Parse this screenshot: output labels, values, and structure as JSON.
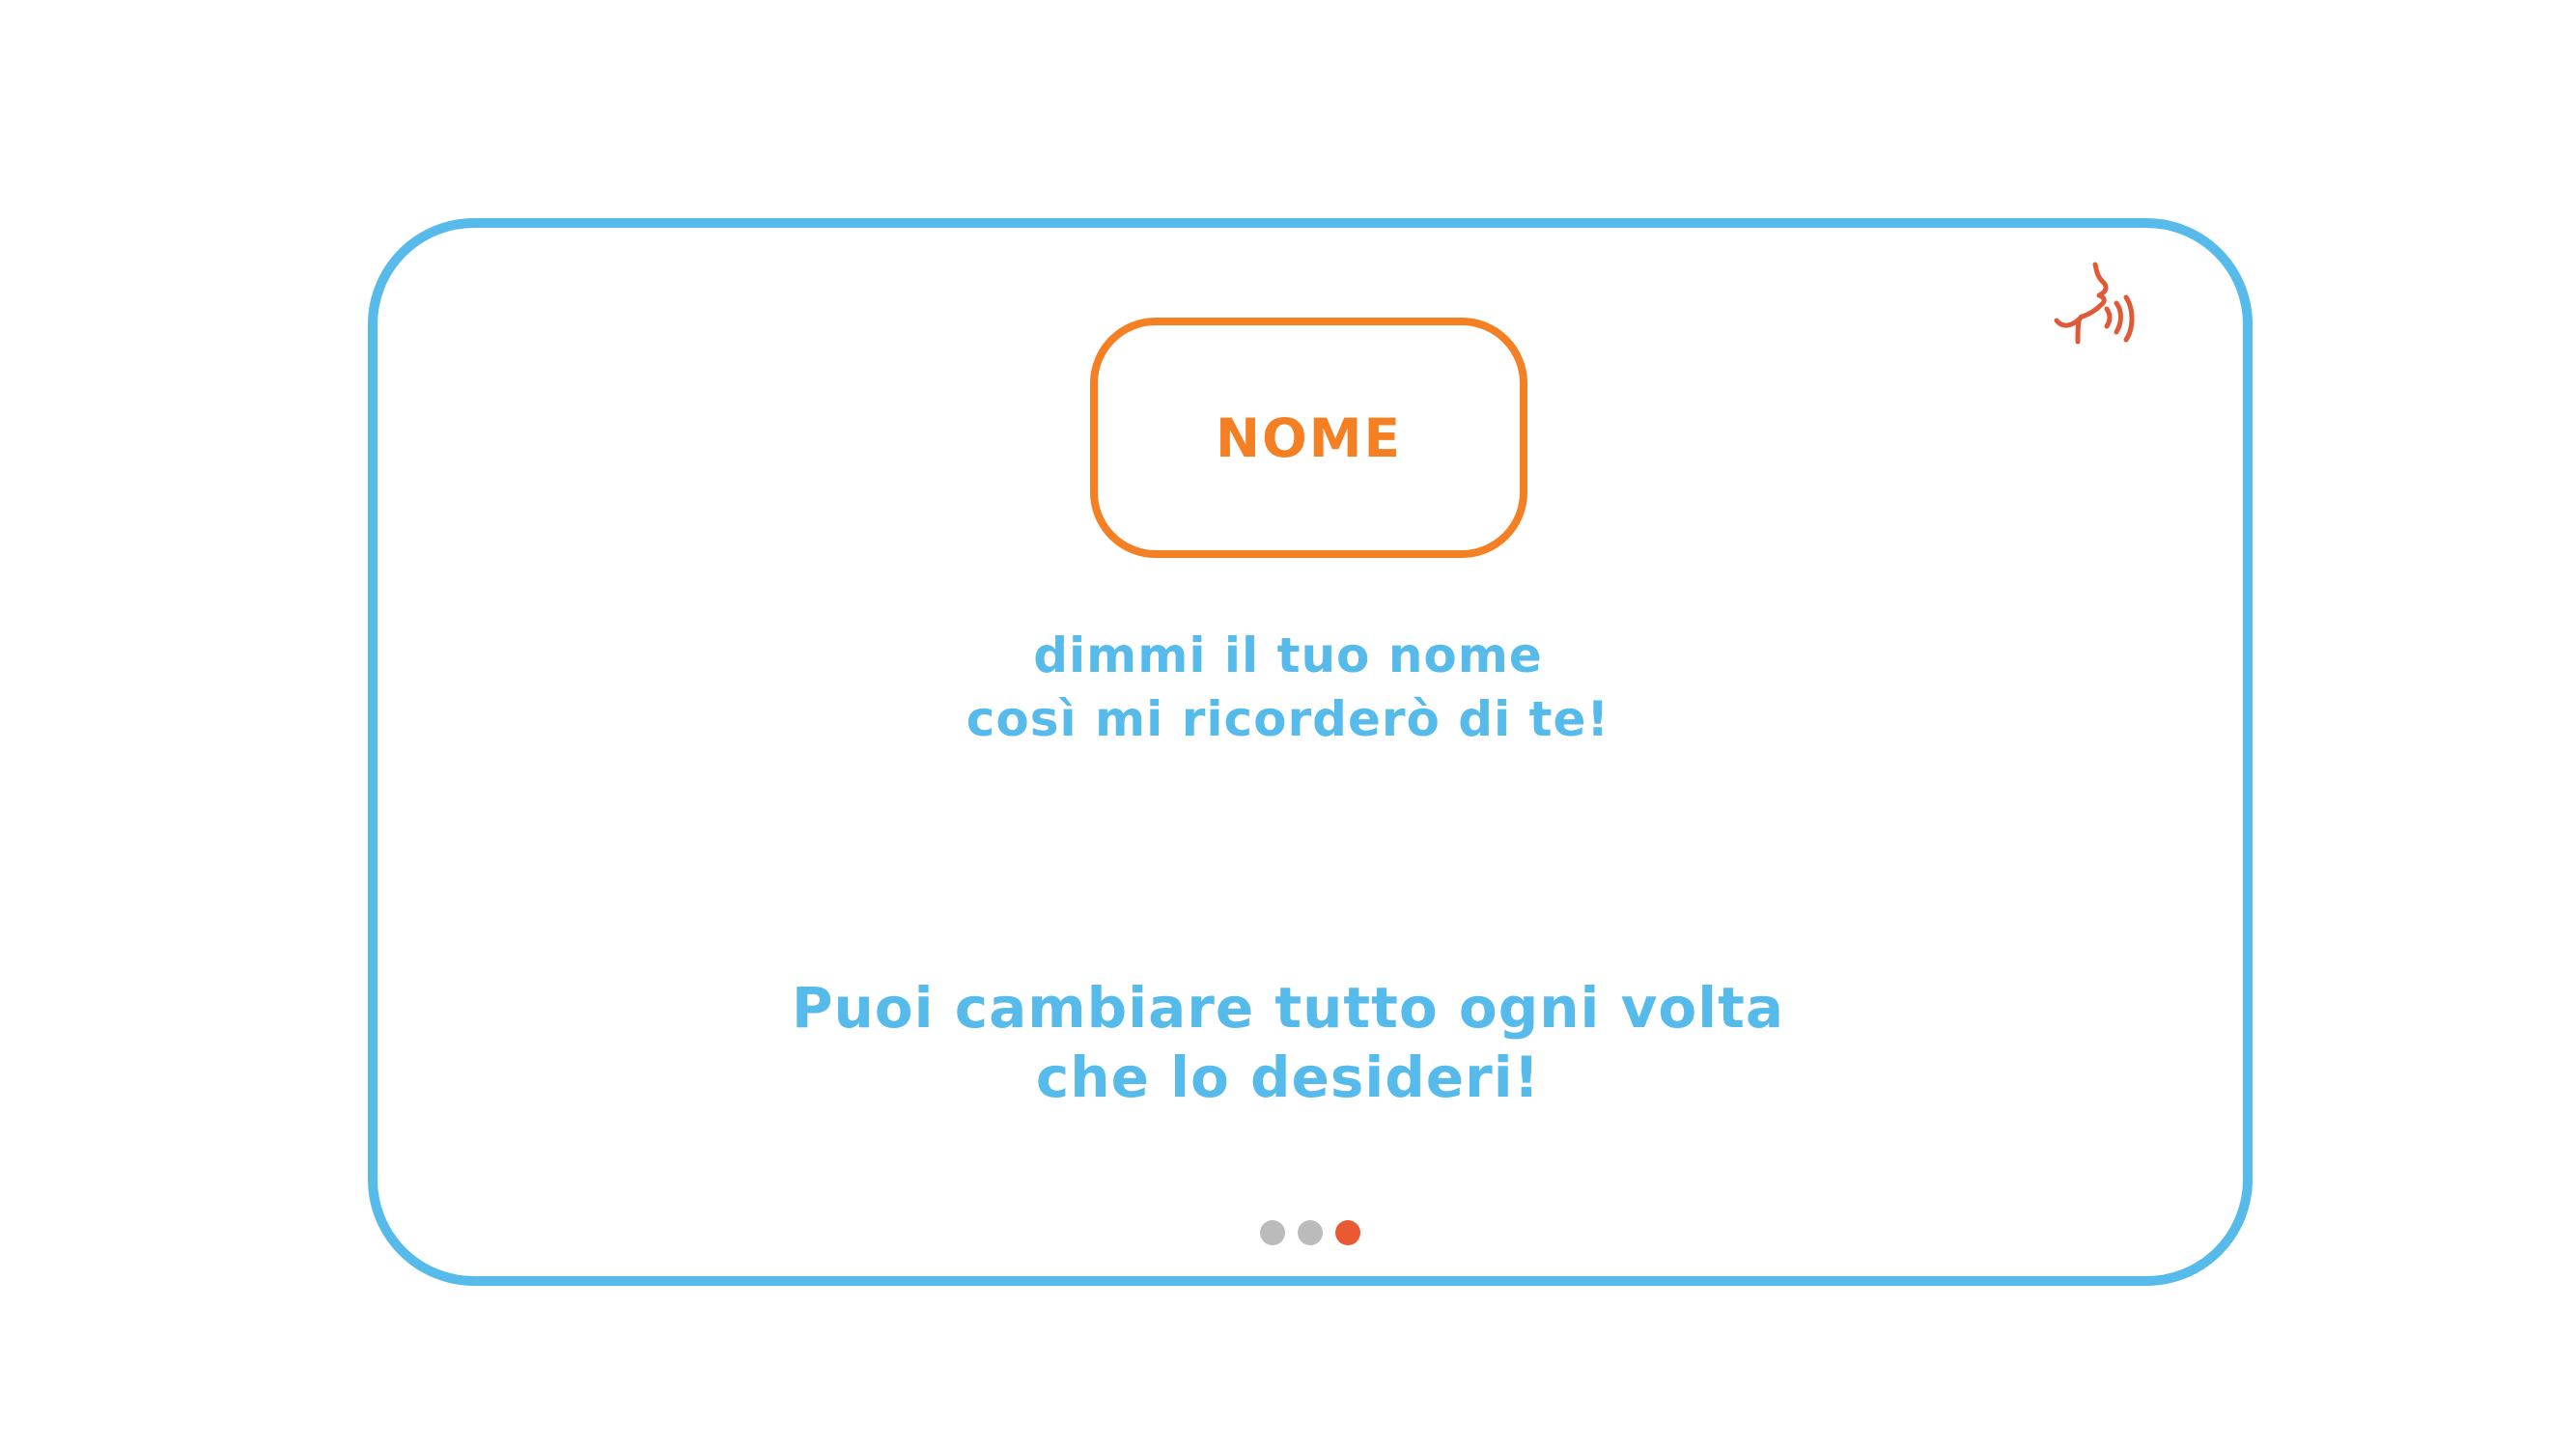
{
  "card": {
    "name_button_label": "NOME",
    "speak_icon": "speaking-head-icon",
    "instruction_line1": "dimmi il tuo nome",
    "instruction_line2": "così mi ricorderò di te!",
    "note_line1": "Puoi cambiare tutto ogni volta",
    "note_line2": "che lo desideri!"
  },
  "pagination": {
    "total": 3,
    "active_index": 2
  },
  "colors": {
    "frame_border": "#56bbeb",
    "name_accent": "#f58024",
    "text": "#56bbeb",
    "icon": "#e05a38",
    "dot_inactive": "#bbbbbb",
    "dot_active": "#e95a33"
  }
}
